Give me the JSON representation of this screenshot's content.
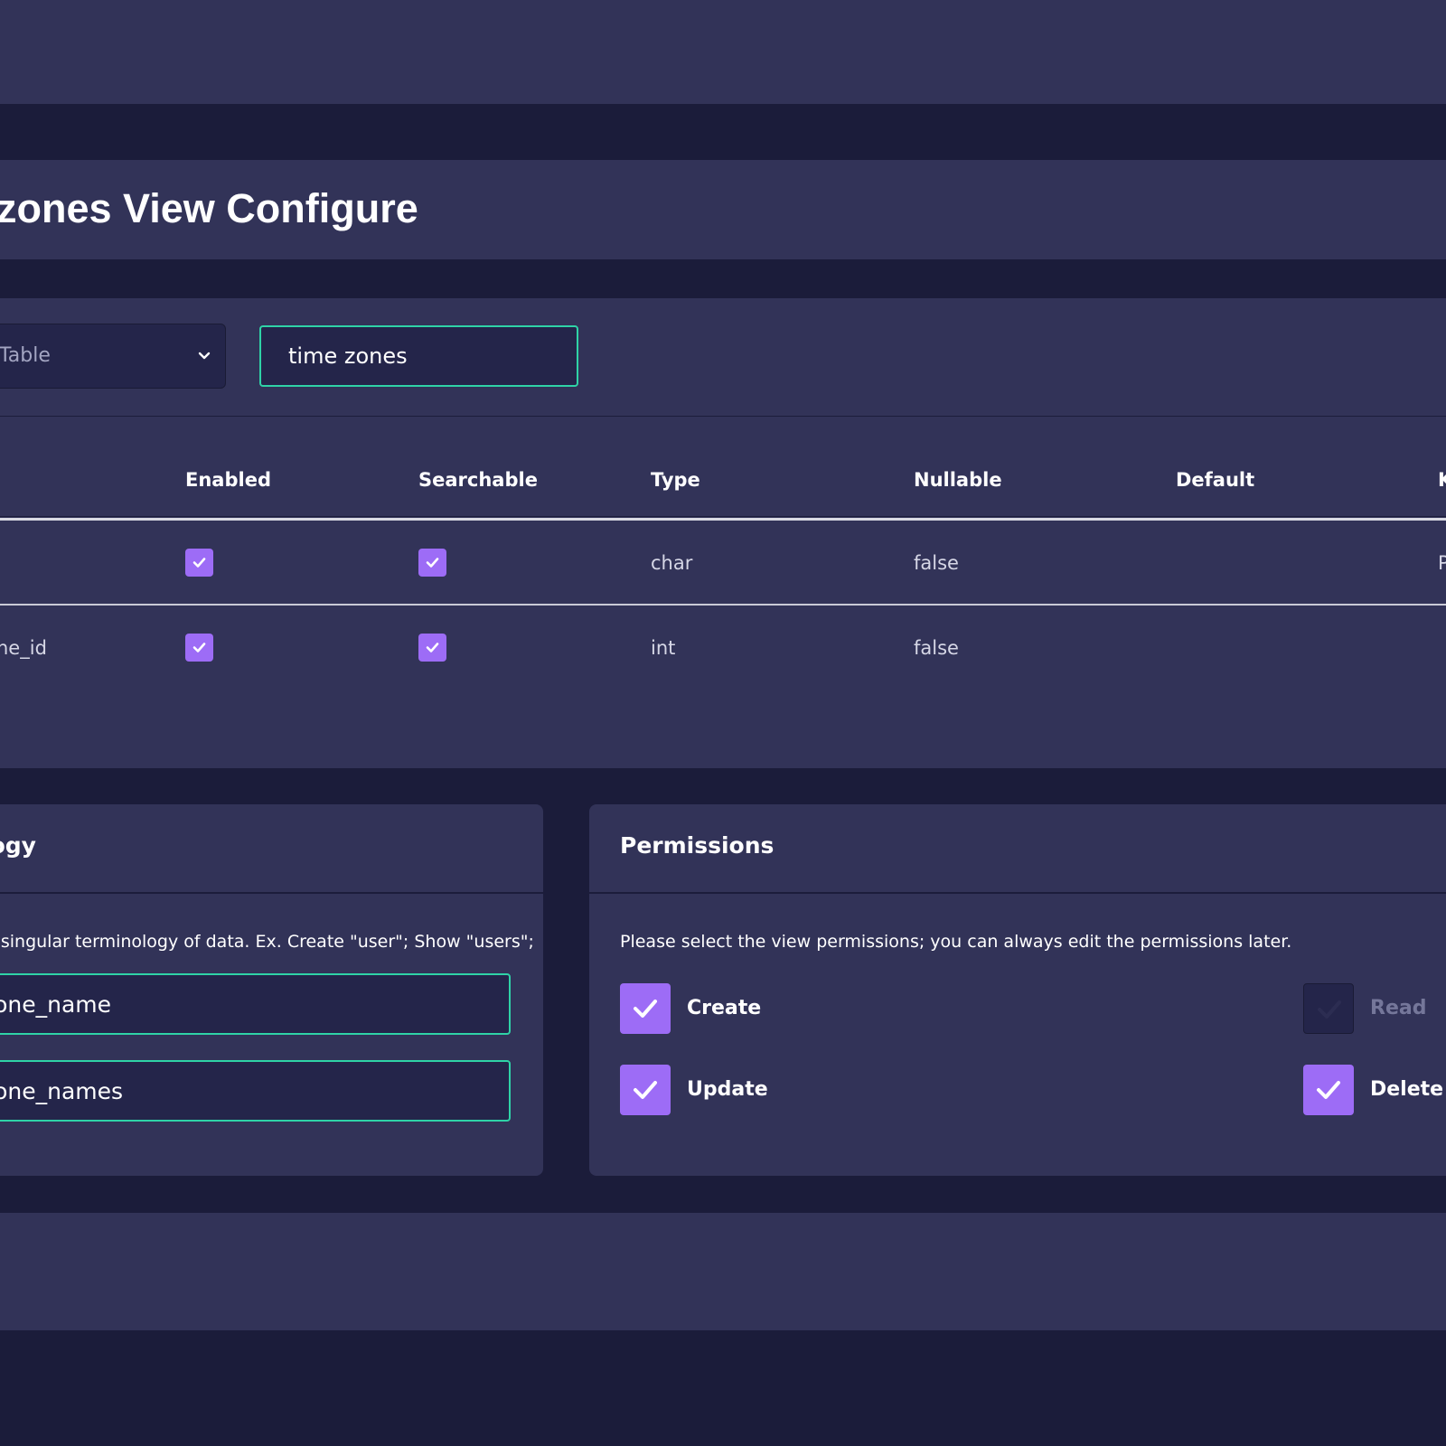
{
  "header": {
    "title": "zones View Configure"
  },
  "form": {
    "table_select": {
      "label": "Table"
    },
    "name_input": {
      "value": "time zones"
    }
  },
  "columns_table": {
    "headers": [
      "Enabled",
      "Searchable",
      "Type",
      "Nullable",
      "Default",
      "K"
    ],
    "rows": [
      {
        "name": "",
        "enabled": true,
        "searchable": true,
        "type": "char",
        "nullable": "false",
        "default": "",
        "key": "P"
      },
      {
        "name": "ne_id",
        "enabled": true,
        "searchable": true,
        "type": "int",
        "nullable": "false",
        "default": "",
        "key": ""
      }
    ]
  },
  "terminology": {
    "title": "logy",
    "description": "& singular terminology of data. Ex. Create \"user\"; Show \"users\";",
    "singular_value": "zone_name",
    "plural_value": "zone_names"
  },
  "permissions": {
    "title": "Permissions",
    "description": "Please select the view permissions; you can always edit the permissions later.",
    "items": [
      {
        "label": "Create",
        "checked": true
      },
      {
        "label": "Read",
        "checked": false
      },
      {
        "label": "Update",
        "checked": true
      },
      {
        "label": "Delete",
        "checked": true
      }
    ]
  },
  "colors": {
    "background": "#1b1c3a",
    "card": "#323358",
    "input": "#24254a",
    "accent_border": "#2fd3a7",
    "checkbox": "#9d6cf6"
  },
  "icons": {
    "select_chevron": "chevron-down-icon",
    "checkbox_mark": "check-icon"
  }
}
